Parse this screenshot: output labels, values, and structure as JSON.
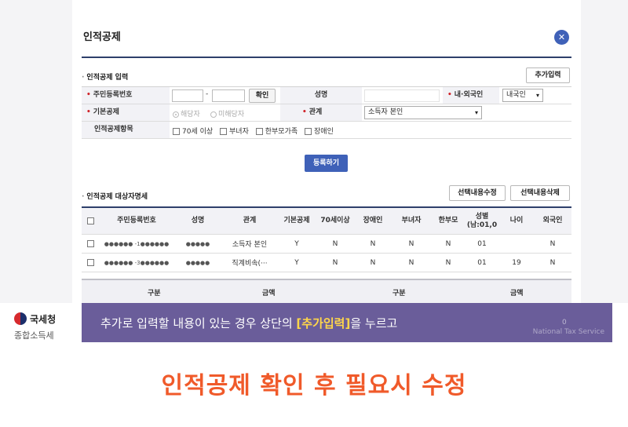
{
  "modal": {
    "title": "인적공제",
    "close_icon": "✕"
  },
  "input_section": {
    "title": "인적공제 입력",
    "add_button": "추가입력",
    "ssn_label": "주민등록번호",
    "ssn_dash": "-",
    "confirm_button": "확인",
    "name_label": "성명",
    "nationality_label": "내·외국인",
    "nationality_value": "내국인",
    "basic_label": "기본공제",
    "basic_options": [
      "해당자",
      "미해당자"
    ],
    "relation_label": "관계",
    "relation_value": "소득자 본인",
    "items_label": "인적공제항목",
    "items": [
      "70세 이상",
      "부녀자",
      "한부모가족",
      "장애인"
    ],
    "register_button": "등록하기"
  },
  "target_section": {
    "title": "인적공제 대상자명세",
    "edit_button": "선택내용수정",
    "delete_button": "선택내용삭제",
    "columns": [
      "주민등록번호",
      "성명",
      "관계",
      "기본공제",
      "70세이상",
      "장애인",
      "부녀자",
      "한부모",
      "성별\n(남:01,0",
      "나이",
      "외국인"
    ],
    "rows": [
      [
        "●●●●●● -1●●●●●●",
        "●●●●●",
        "소득자 본인",
        "Y",
        "N",
        "N",
        "N",
        "N",
        "01",
        "",
        "N"
      ],
      [
        "●●●●●● -3●●●●●●",
        "●●●●●",
        "직계비속(···",
        "Y",
        "N",
        "N",
        "N",
        "N",
        "01",
        "19",
        "N"
      ]
    ]
  },
  "summary": {
    "headers": [
      "구분",
      "금액",
      "구분",
      "금액"
    ]
  },
  "banner": {
    "text_before": "추가로 입력할 내용이 있는 경우 상단의 ",
    "highlight": "[추가입력]",
    "text_after": "을 누르고",
    "watermark": "National Tax Service",
    "faint_zero": "0"
  },
  "logo": {
    "name": "국세청",
    "sub": "종합소득세"
  },
  "subtitle": "인적공제 확인 후 필요시 수정",
  "colors": {
    "accent_blue": "#3f61b8",
    "banner_purple": "#6a5d9a",
    "highlight_yellow": "#ffd64a",
    "subtitle_orange": "#f05a2a",
    "required_red": "#d0232a"
  }
}
